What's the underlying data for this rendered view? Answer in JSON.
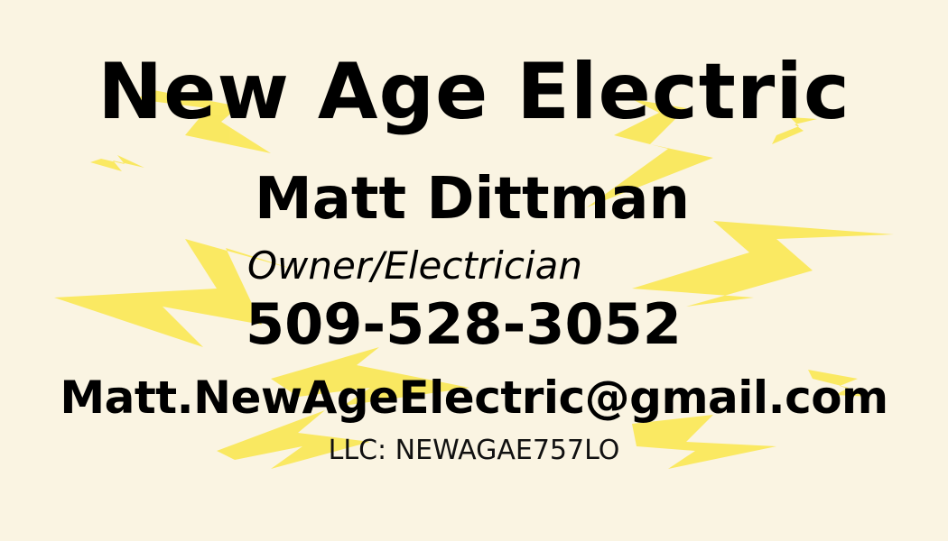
{
  "card": {
    "company_name": "New Age Electric",
    "person_name": "Matt Dittman",
    "role": "Owner/Electrician",
    "phone": "509-528-3052",
    "email": "Matt.NewAgeElectric@gmail.com",
    "llc": "LLC: NEWAGAE757LO"
  },
  "colors": {
    "background": "#faf4e2",
    "lightning": "#f9e64b",
    "text": "#000000"
  },
  "icons": [
    "lightning-bolt-icon"
  ]
}
